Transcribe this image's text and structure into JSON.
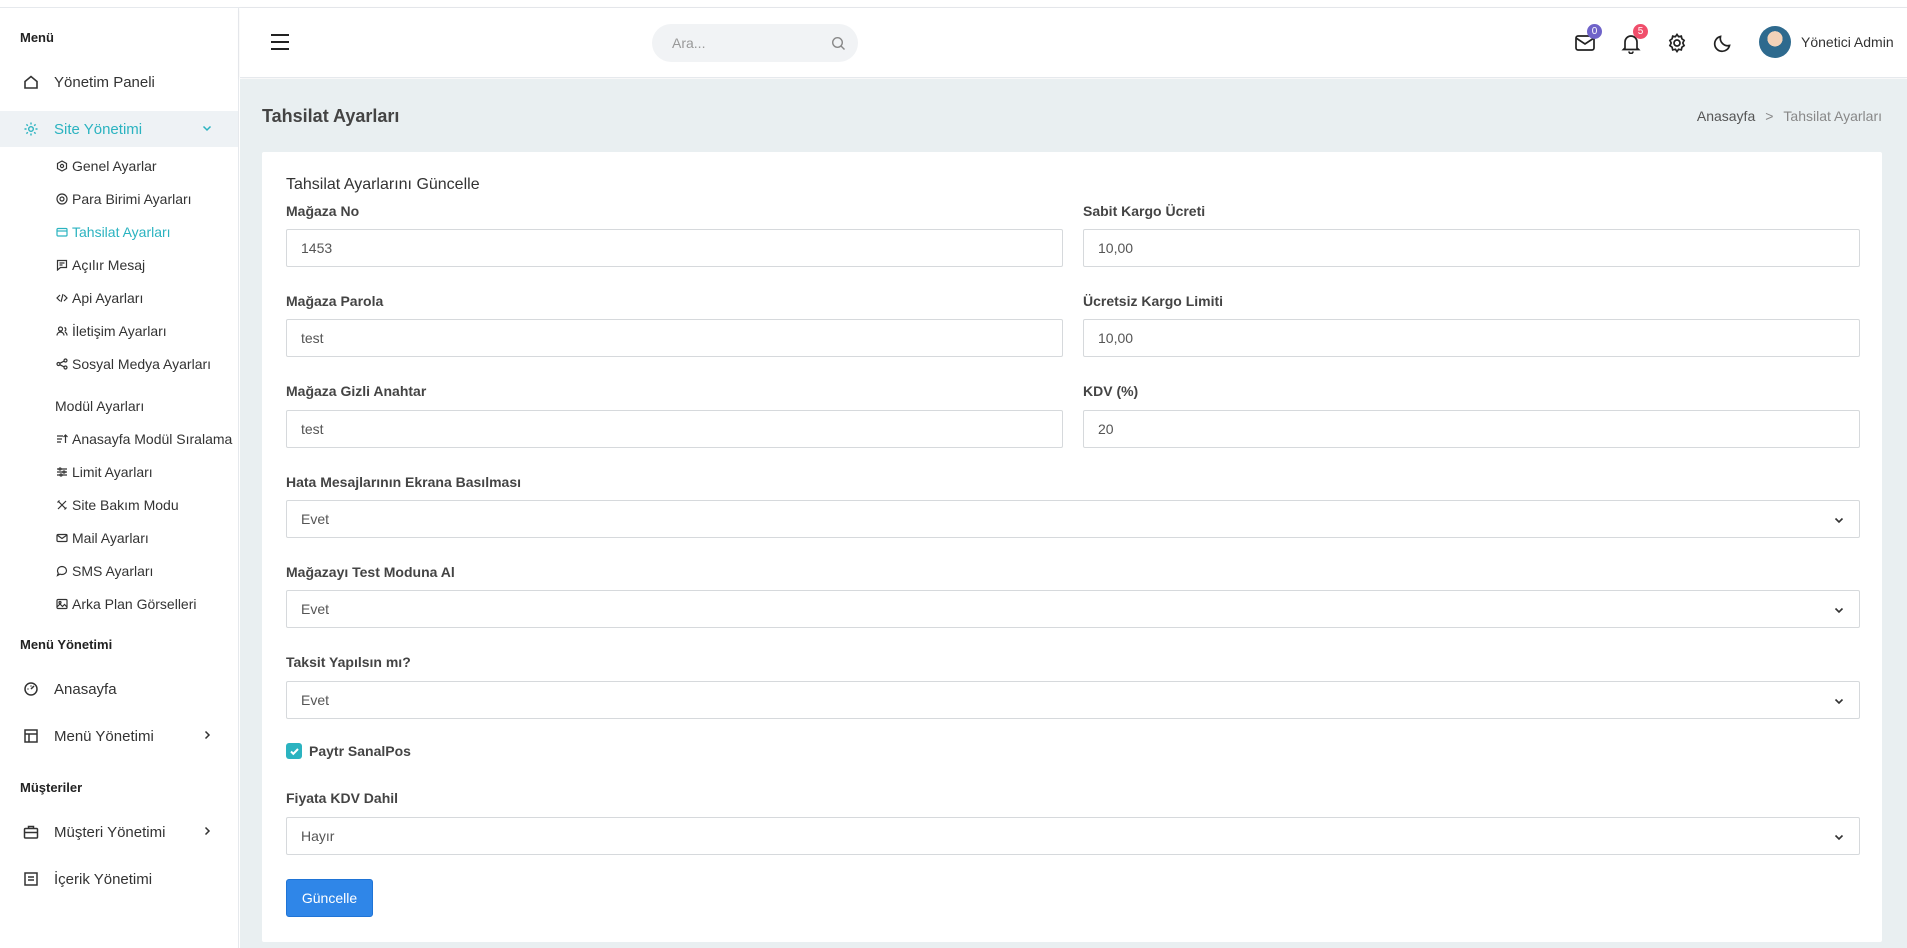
{
  "sidebar": {
    "section_menu": "Menü",
    "items_top": [
      {
        "label": "Yönetim Paneli",
        "icon": "home-icon"
      },
      {
        "label": "Site Yönetimi",
        "icon": "gear-icon"
      }
    ],
    "sub_items": [
      {
        "label": "Genel Ayarlar",
        "icon": "cog-small-icon"
      },
      {
        "label": "Para Birimi Ayarları",
        "icon": "currency-icon"
      },
      {
        "label": "Tahsilat Ayarları",
        "icon": "card-icon"
      },
      {
        "label": "Açılır Mesaj",
        "icon": "message-icon"
      },
      {
        "label": "Api Ayarları",
        "icon": "code-icon"
      },
      {
        "label": "İletişim Ayarları",
        "icon": "contacts-icon"
      },
      {
        "label": "Sosyal Medya Ayarları",
        "icon": "share-icon"
      },
      {
        "label": "Modül Ayarları",
        "icon": ""
      },
      {
        "label": "Anasayfa Modül Sıralama",
        "icon": "sort-icon"
      },
      {
        "label": "Limit Ayarları",
        "icon": "sliders-icon"
      },
      {
        "label": "Site Bakım Modu",
        "icon": "tools-icon"
      },
      {
        "label": "Mail Ayarları",
        "icon": "mail-icon"
      },
      {
        "label": "SMS Ayarları",
        "icon": "chat-icon"
      },
      {
        "label": "Arka Plan Görselleri",
        "icon": "image-icon"
      }
    ],
    "section_menu_mgmt": "Menü Yönetimi",
    "items_mid": [
      {
        "label": "Anasayfa",
        "icon": "dashboard-icon"
      },
      {
        "label": "Menü Yönetimi",
        "icon": "layout-icon"
      }
    ],
    "section_customers": "Müşteriler",
    "items_bottom": [
      {
        "label": "Müşteri Yönetimi",
        "icon": "briefcase-icon"
      },
      {
        "label": "İçerik Yönetimi",
        "icon": "content-icon"
      }
    ]
  },
  "header": {
    "search_placeholder": "Ara...",
    "mail_badge": "0",
    "notif_badge": "5",
    "user_name": "Yönetici Admin"
  },
  "page": {
    "title": "Tahsilat Ayarları",
    "breadcrumb_home": "Anasayfa",
    "breadcrumb_sep": ">",
    "breadcrumb_current": "Tahsilat Ayarları"
  },
  "form": {
    "title": "Tahsilat Ayarlarını Güncelle",
    "store_no_label": "Mağaza No",
    "store_no_value": "1453",
    "shipping_fee_label": "Sabit Kargo Ücreti",
    "shipping_fee_value": "10,00",
    "store_password_label": "Mağaza Parola",
    "store_password_value": "test",
    "free_shipping_label": "Ücretsiz Kargo Limiti",
    "free_shipping_value": "10,00",
    "secret_key_label": "Mağaza Gizli Anahtar",
    "secret_key_value": "test",
    "kdv_label": "KDV (%)",
    "kdv_value": "20",
    "error_display_label": "Hata Mesajlarının Ekrana Basılması",
    "error_display_value": "Evet",
    "test_mode_label": "Mağazayı Test Moduna Al",
    "test_mode_value": "Evet",
    "installment_label": "Taksit Yapılsın mı?",
    "installment_value": "Evet",
    "paytr_label": "Paytr SanalPos",
    "paytr_checked": true,
    "kdv_included_label": "Fiyata KDV Dahil",
    "kdv_included_value": "Hayır",
    "submit_label": "Güncelle"
  },
  "colors": {
    "accent": "#2bb3c0",
    "button": "#2f86e8",
    "content_bg": "#e9eff1",
    "mail_badge": "#6f63c9",
    "notif_badge": "#f04e6b"
  }
}
